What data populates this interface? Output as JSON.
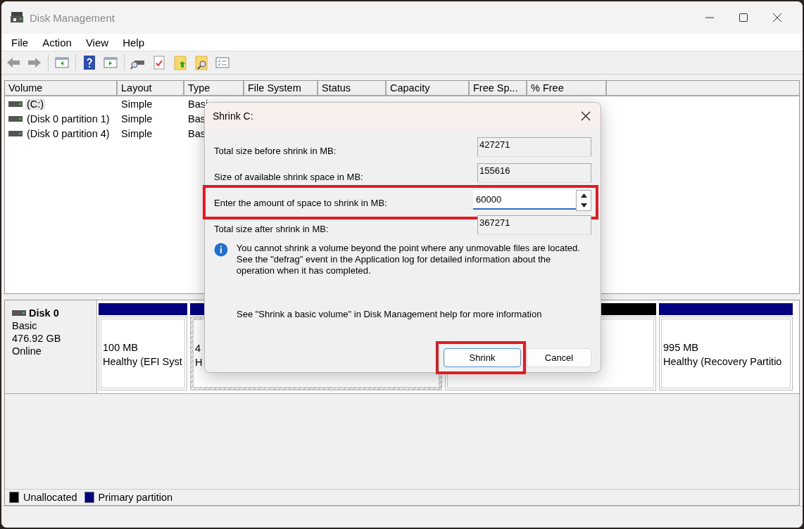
{
  "window": {
    "title": "Disk Management"
  },
  "menu": [
    "File",
    "Action",
    "View",
    "Help"
  ],
  "volumes": {
    "columns": [
      "Volume",
      "Layout",
      "Type",
      "File System",
      "Status",
      "Capacity",
      "Free Sp...",
      "% Free"
    ],
    "rows": [
      {
        "selected": true,
        "cells": [
          "(C:)",
          "Simple",
          "Basi"
        ]
      },
      {
        "selected": false,
        "cells": [
          "(Disk 0 partition 1)",
          "Simple",
          "Bas"
        ]
      },
      {
        "selected": false,
        "cells": [
          "(Disk 0 partition 4)",
          "Simple",
          "Bas"
        ]
      }
    ]
  },
  "disks": [
    {
      "name": "Disk 0",
      "type": "Basic",
      "size": "476.92 GB",
      "status": "Online",
      "partitions": [
        {
          "kind": "primary",
          "selected": false,
          "lines": [
            "100 MB",
            "Healthy (EFI Syst"
          ]
        },
        {
          "kind": "primary",
          "selected": true,
          "lines": [
            "4",
            "H"
          ]
        },
        {
          "kind": "unallocated",
          "selected": false
        },
        {
          "kind": "primary",
          "selected": false,
          "lines": [
            "995 MB",
            "Healthy (Recovery Partitio"
          ]
        }
      ]
    }
  ],
  "legend": [
    {
      "label": "Unallocated",
      "color": "#000000"
    },
    {
      "label": "Primary partition",
      "color": "#000080"
    }
  ],
  "dialog": {
    "title": "Shrink C:",
    "fields": [
      {
        "kind": "readonly",
        "label": "Total size before shrink in MB:",
        "value": "427271"
      },
      {
        "kind": "readonly",
        "label": "Size of available shrink space in MB:",
        "value": "155616"
      },
      {
        "kind": "spin",
        "label": "Enter the amount of space to shrink in MB:",
        "value": "60000",
        "highlighted": true
      },
      {
        "kind": "readonly",
        "label": "Total size after shrink in MB:",
        "value": "367271"
      }
    ],
    "info": "You cannot shrink a volume beyond the point where any unmovable files are located. See the \"defrag\" event in the Application log for detailed information about the operation when it has completed.",
    "help": "See \"Shrink a basic volume\" in Disk Management help for more information",
    "buttons": [
      {
        "label": "Shrink",
        "default": true,
        "highlighted": true
      },
      {
        "label": "Cancel",
        "default": false,
        "highlighted": false
      }
    ]
  }
}
